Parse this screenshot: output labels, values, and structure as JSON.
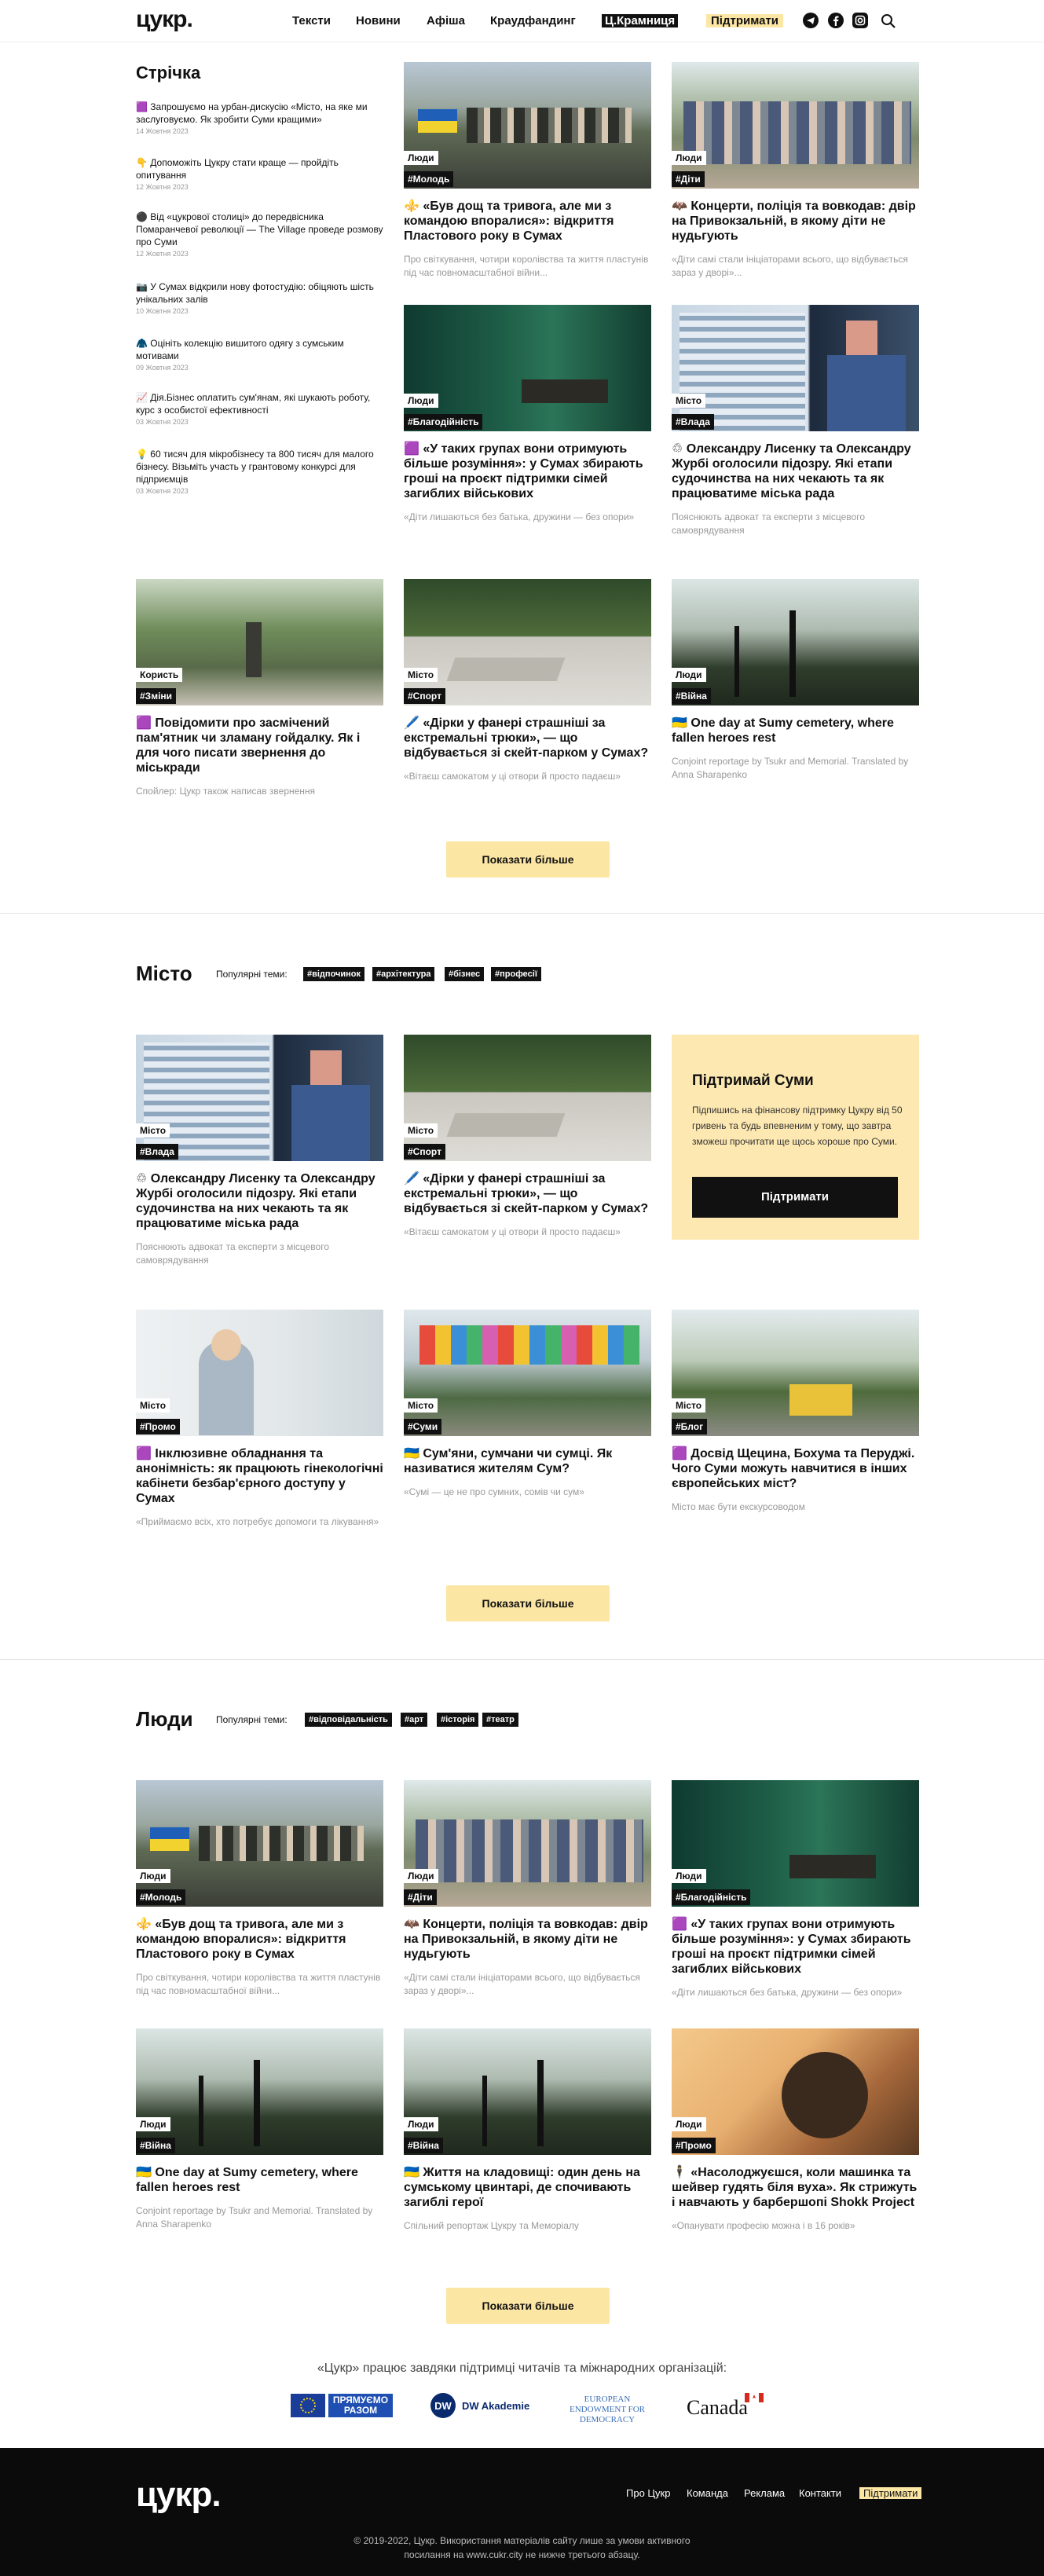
{
  "header": {
    "logo": "цукр.",
    "nav": [
      "Тексти",
      "Новини",
      "Афіша",
      "Краудфандинг",
      "Ц.Крамниця",
      "Підтримати"
    ],
    "social_icons": [
      "telegram-icon",
      "facebook-icon",
      "instagram-icon"
    ],
    "search_icon": "search-icon"
  },
  "feed": {
    "title": "Стрічка",
    "items": [
      {
        "emoji": "🟪",
        "text": "Запрошуємо на урбан-дискусію «Місто, на яке ми заслуговуємо. Як зробити Суми кращими»",
        "date": "14 Жовтня 2023"
      },
      {
        "emoji": "👇",
        "text": "Допоможіть Цукру стати краще — пройдіть опитування",
        "date": "12 Жовтня 2023"
      },
      {
        "emoji": "⚫",
        "text": "Від «цукрової столиці» до передвісника Помаранчевої революції — The Village проведе розмову про Суми",
        "date": "12 Жовтня 2023"
      },
      {
        "emoji": "📷",
        "text": "У Сумах відкрили нову фотостудію: обіцяють шість унікальних залів",
        "date": "10 Жовтня 2023"
      },
      {
        "emoji": "🧥",
        "text": "Оцініть колекцію вишитого одягу з сумським мотивами",
        "date": "09 Жовтня 2023"
      },
      {
        "emoji": "📈",
        "text": "Дія.Бізнес оплатить сум'янам, які шукають роботу, курс з особистої ефективності",
        "date": "03 Жовтня 2023"
      },
      {
        "emoji": "💡",
        "text": "60 тисяч для мікробізнесу та 800 тисяч для малого бізнесу. Візьміть участь у грантовому конкурсі для підприємців",
        "date": "03 Жовтня 2023"
      }
    ]
  },
  "top_cards": [
    {
      "section": "Люди",
      "tag": "#Молодь",
      "emoji": "⚜️",
      "title": "«Був дощ та тривога, але ми з командою впоралися»: відкриття Пластового року в Сумах",
      "lead": "Про світкування, чотири королівства та життя пластунів під час повномасштабної війни..."
    },
    {
      "section": "Люди",
      "tag": "#Діти",
      "emoji": "🦇",
      "title": "Концерти, поліція та вовкодав: двір на Привокзальній, в якому діти не нудьгують",
      "lead": "«Діти самі стали ініціаторами всього, що відбувається зараз у дворі»..."
    },
    {
      "section": "Люди",
      "tag": "#Благодійність",
      "emoji": "🟪",
      "title": "«У таких групах вони отримують більше розуміння»: у Сумах збирають гроші на проєкт підтримки сімей загиблих військових",
      "lead": "«Діти лишаються без батька, дружини — без опори»"
    },
    {
      "section": "Місто",
      "tag": "#Влада",
      "emoji": "♲",
      "title": "Олександру Лисенку та Олександру Журбі оголосили підозру. Які етапи судочинства на них чекають та як працюватиме міська рада",
      "lead": "Пояснюють адвокат та експерти з місцевого самоврядування"
    },
    {
      "section": "Користь",
      "tag": "#Зміни",
      "emoji": "🟪",
      "title": "Повідомити про засмічений пам'ятник чи зламану гойдалку. Як і для чого писати звернення до міськради",
      "lead": "Спойлер: Цукр також написав звернення"
    },
    {
      "section": "Місто",
      "tag": "#Спорт",
      "emoji": "🖊️",
      "title": "«Дірки у фанері страшніші за екстремальні трюки», — що відбувається зі скейт-парком у Сумах?",
      "lead": "«Вітаєш самокатом у ці отвори й просто падаєш»"
    },
    {
      "section": "Люди",
      "tag": "#Війна",
      "emoji": "🇺🇦",
      "title": "One day at Sumy cemetery, where fallen heroes rest",
      "lead": "Conjoint reportage by Tsukr and Memorial. Translated by Anna Sharapenko"
    }
  ],
  "more_label": "Показати більше",
  "city": {
    "title": "Місто",
    "popular_label": "Популярні теми:",
    "chips": [
      "#відпочинок",
      "#архітектура",
      "#бізнес",
      "#професії"
    ],
    "cards": [
      {
        "section": "Місто",
        "tag": "#Влада",
        "emoji": "♲",
        "title": "Олександру Лисенку та Олександру Журбі оголосили підозру. Які етапи судочинства на них чекають та як працюватиме міська рада",
        "lead": "Пояснюють адвокат та експерти з місцевого самоврядування"
      },
      {
        "section": "Місто",
        "tag": "#Спорт",
        "emoji": "🖊️",
        "title": "«Дірки у фанері страшніші за екстремальні трюки», — що відбувається зі скейт-парком у Сумах?",
        "lead": "«Вітаєш самокатом у ці отвори й просто падаєш»"
      },
      {
        "section": "Місто",
        "tag": "#Промо",
        "emoji": "🟪",
        "title": "Інклюзивне обладнання та анонімність: як працюють гінекологічні кабінети безбар'єрного доступу у Сумах",
        "lead": "«Приймаємо всіх, хто потребує допомоги та лікування»"
      },
      {
        "section": "Місто",
        "tag": "#Суми",
        "emoji": "🇺🇦",
        "title": "Сум'яни, сумчани чи сумці. Як називатися жителям Сум?",
        "lead": "«Сумі — це не про сумних, сомів чи сум»"
      },
      {
        "section": "Місто",
        "tag": "#Блог",
        "emoji": "🟪",
        "title": "Досвід Щецина, Бохума та Перуджі. Чого Суми можуть навчитися в інших європейських міст?",
        "lead": "Місто має бути екскурсоводом"
      }
    ],
    "support": {
      "title": "Підтримай Суми",
      "text": "Підпишись на фінансову підтримку Цукру від 50 гривень та будь впевненим у тому, що завтра зможеш прочитати ще щось хороше про Суми.",
      "button": "Підтримати"
    }
  },
  "people": {
    "title": "Люди",
    "popular_label": "Популярні теми:",
    "chips": [
      "#відповідальність",
      "#арт",
      "#історія",
      "#театр"
    ],
    "cards": [
      {
        "section": "Люди",
        "tag": "#Молодь",
        "emoji": "⚜️",
        "title": "«Був дощ та тривога, але ми з командою впоралися»: відкриття Пластового року в Сумах",
        "lead": "Про світкування, чотири королівства та життя пластунів під час повномасштабної війни..."
      },
      {
        "section": "Люди",
        "tag": "#Діти",
        "emoji": "🦇",
        "title": "Концерти, поліція та вовкодав: двір на Привокзальній, в якому діти не нудьгують",
        "lead": "«Діти самі стали ініціаторами всього, що відбувається зараз у дворі»..."
      },
      {
        "section": "Люди",
        "tag": "#Благодійність",
        "emoji": "🟪",
        "title": "«У таких групах вони отримують більше розуміння»: у Сумах збирають гроші на проєкт підтримки сімей загиблих військових",
        "lead": "«Діти лишаються без батька, дружини — без опори»"
      },
      {
        "section": "Люди",
        "tag": "#Війна",
        "emoji": "🇺🇦",
        "title": "One day at Sumy cemetery, where fallen heroes rest",
        "lead": "Conjoint reportage by Tsukr and Memorial. Translated by Anna Sharapenko"
      },
      {
        "section": "Люди",
        "tag": "#Війна",
        "emoji": "🇺🇦",
        "title": "Життя на кладовищі: один день на сумському цвинтарі, де спочивають загиблі герої",
        "lead": "Спільний репортаж Цукру та Меморіалу"
      },
      {
        "section": "Люди",
        "tag": "#Промо",
        "emoji": "🕴️",
        "title": "«Насолоджуєшся, коли машинка та шейвер гудять біля вуха». Як стрижуть і навчають у барбершопі Shokk Project",
        "lead": "«Опанувати професію можна і в 16 років»"
      }
    ]
  },
  "partners": {
    "text": "«Цукр» працює завдяки підтримці читачів та міжнародних організацій:",
    "logos": [
      {
        "name": "ПРЯМУЄМО РАЗОМ"
      },
      {
        "name": "DW Akademie"
      },
      {
        "name": "EUROPEAN ENDOWMENT FOR DEMOCRACY"
      },
      {
        "name": "Canada"
      }
    ]
  },
  "footer": {
    "logo": "цукр.",
    "nav": [
      "Про Цукр",
      "Команда",
      "Реклама",
      "Контакти",
      "Підтримати"
    ],
    "copyright": "© 2019-2022, Цукр. Використання матеріалів сайту лише за умови активного",
    "copyright2": "посилання на www.cukr.city не нижче третього абзацу."
  }
}
